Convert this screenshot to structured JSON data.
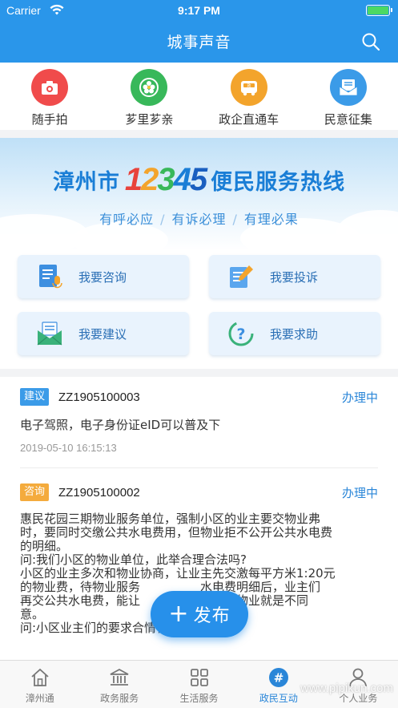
{
  "status": {
    "carrier": "Carrier",
    "time": "9:17 PM",
    "battery_level": 1.0
  },
  "header": {
    "title": "城事声音"
  },
  "quick": [
    {
      "label": "随手拍",
      "icon": "camera-icon",
      "color": "#f04b4b"
    },
    {
      "label": "芗里芗亲",
      "icon": "flower-icon",
      "color": "#38b85a"
    },
    {
      "label": "政企直通车",
      "icon": "bus-icon",
      "color": "#f3a42c"
    },
    {
      "label": "民意征集",
      "icon": "mail-icon",
      "color": "#3b9be8"
    }
  ],
  "banner": {
    "city": "漳州市",
    "number": "12345",
    "hotline": "便民服务热线",
    "slogans": [
      "有呼必应",
      "有诉必理",
      "有理必果"
    ]
  },
  "services": [
    {
      "label": "我要咨询",
      "icon": "document-microphone-icon"
    },
    {
      "label": "我要投诉",
      "icon": "document-pen-icon"
    },
    {
      "label": "我要建议",
      "icon": "envelope-icon"
    },
    {
      "label": "我要求助",
      "icon": "help-question-icon"
    }
  ],
  "items": [
    {
      "tag": "建议",
      "code": "ZZ1905100003",
      "state": "办理中",
      "lines": [
        "电子驾照，电子身份证eID可以普及下"
      ],
      "time": "2019-05-10 16:15:13"
    },
    {
      "tag": "咨询",
      "code": "ZZ1905100002",
      "state": "办理中",
      "lines": [
        "惠民花园三期物业服务单位，强制小区的业主要交物业弗",
        "时，要同时交缴公共水电费用，但物业拒不公开公共水电费",
        "的明细。",
        "问:我们小区的物业单位，此举合理合法吗?",
        "小区的业主多次和物业协商，让业主先交激每平方米1:20元",
        "的物业费，待物业服务　　　　　水电费明细后，业主们",
        "再交公共水电费，能让　　　　　消费。物业就是不同",
        "意。",
        "问:小区业主们的要求合情合理合法吗?"
      ]
    }
  ],
  "fab": {
    "label": "发布"
  },
  "tabs": [
    {
      "label": "漳州通",
      "icon": "home-icon"
    },
    {
      "label": "政务服务",
      "icon": "government-building-icon"
    },
    {
      "label": "生活服务",
      "icon": "grid-icon"
    },
    {
      "label": "政民互动",
      "icon": "hashtag-icon"
    },
    {
      "label": "个人业务",
      "icon": "person-icon"
    }
  ],
  "active_tab": "政民互动",
  "watermark": "www.pipikun.com",
  "colors": {
    "primary": "#2a96ea",
    "tag_suggest": "#3b9be8",
    "tag_consult": "#f4ab3d",
    "state": "#2a86d8"
  }
}
